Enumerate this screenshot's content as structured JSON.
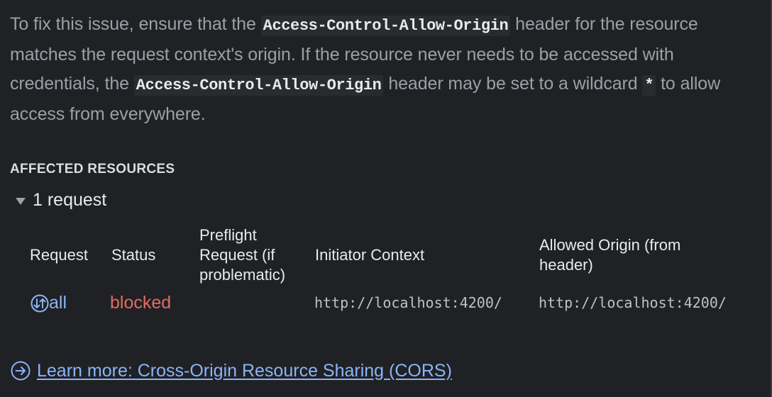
{
  "description": {
    "part1": "To fix this issue, ensure that the ",
    "code1": "Access-Control-Allow-Origin",
    "part2": " header for the resource matches the request context's origin. If the resource never needs to be accessed with credentials, the ",
    "code2": "Access-Control-Allow-Origin",
    "part3": " header may be set to a wildcard ",
    "code3": "*",
    "part4": " to allow access from everywhere."
  },
  "affected": {
    "title": "AFFECTED RESOURCES",
    "toggle_label": "1 request",
    "expanded": true,
    "columns": {
      "request": "Request",
      "status": "Status",
      "preflight_l1": "Preflight",
      "preflight_l2": "Request (if",
      "preflight_l3": "problematic)",
      "initiator": "Initiator Context",
      "allowed_l1": "Allowed Origin (from",
      "allowed_l2": "header)"
    },
    "rows": [
      {
        "request": "all",
        "request_icon": "network-request-icon",
        "status": "blocked",
        "preflight": "",
        "initiator": "http://localhost:4200/",
        "allowed_origin": "http://localhost:4200/"
      }
    ]
  },
  "learn_more": {
    "icon": "arrow-right-circle-icon",
    "label": "Learn more: Cross-Origin Resource Sharing (CORS)"
  },
  "colors": {
    "background": "#202124",
    "text_secondary": "#9aa0a6",
    "link": "#8ab4f8",
    "error": "#e46962"
  }
}
